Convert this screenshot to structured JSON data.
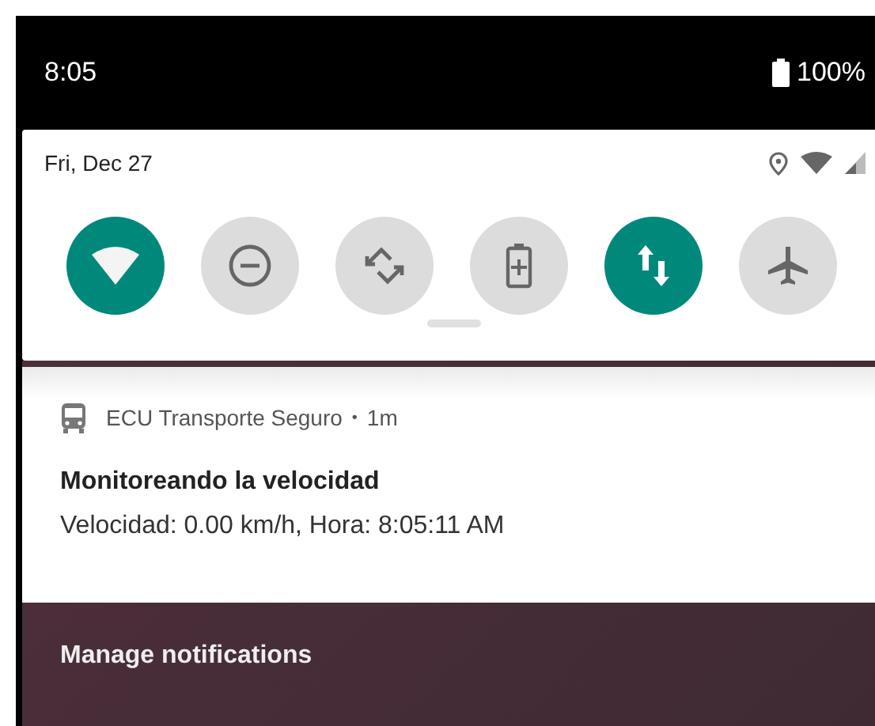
{
  "status_bar": {
    "time": "8:05",
    "battery": "100%"
  },
  "quick_settings": {
    "date": "Fri, Dec 27",
    "tiles": [
      {
        "kind": "wifi",
        "on": true
      },
      {
        "kind": "dnd",
        "on": false
      },
      {
        "kind": "rotate",
        "on": false
      },
      {
        "kind": "battery_saver",
        "on": false
      },
      {
        "kind": "data",
        "on": true
      },
      {
        "kind": "airplane",
        "on": false
      }
    ]
  },
  "notification": {
    "app": "ECU Transporte Seguro",
    "separator": "•",
    "time": "1m",
    "title": "Monitoreando la velocidad",
    "text": "Velocidad: 0.00 km/h, Hora: 8:05:11 AM"
  },
  "manage_label": "Manage notifications"
}
